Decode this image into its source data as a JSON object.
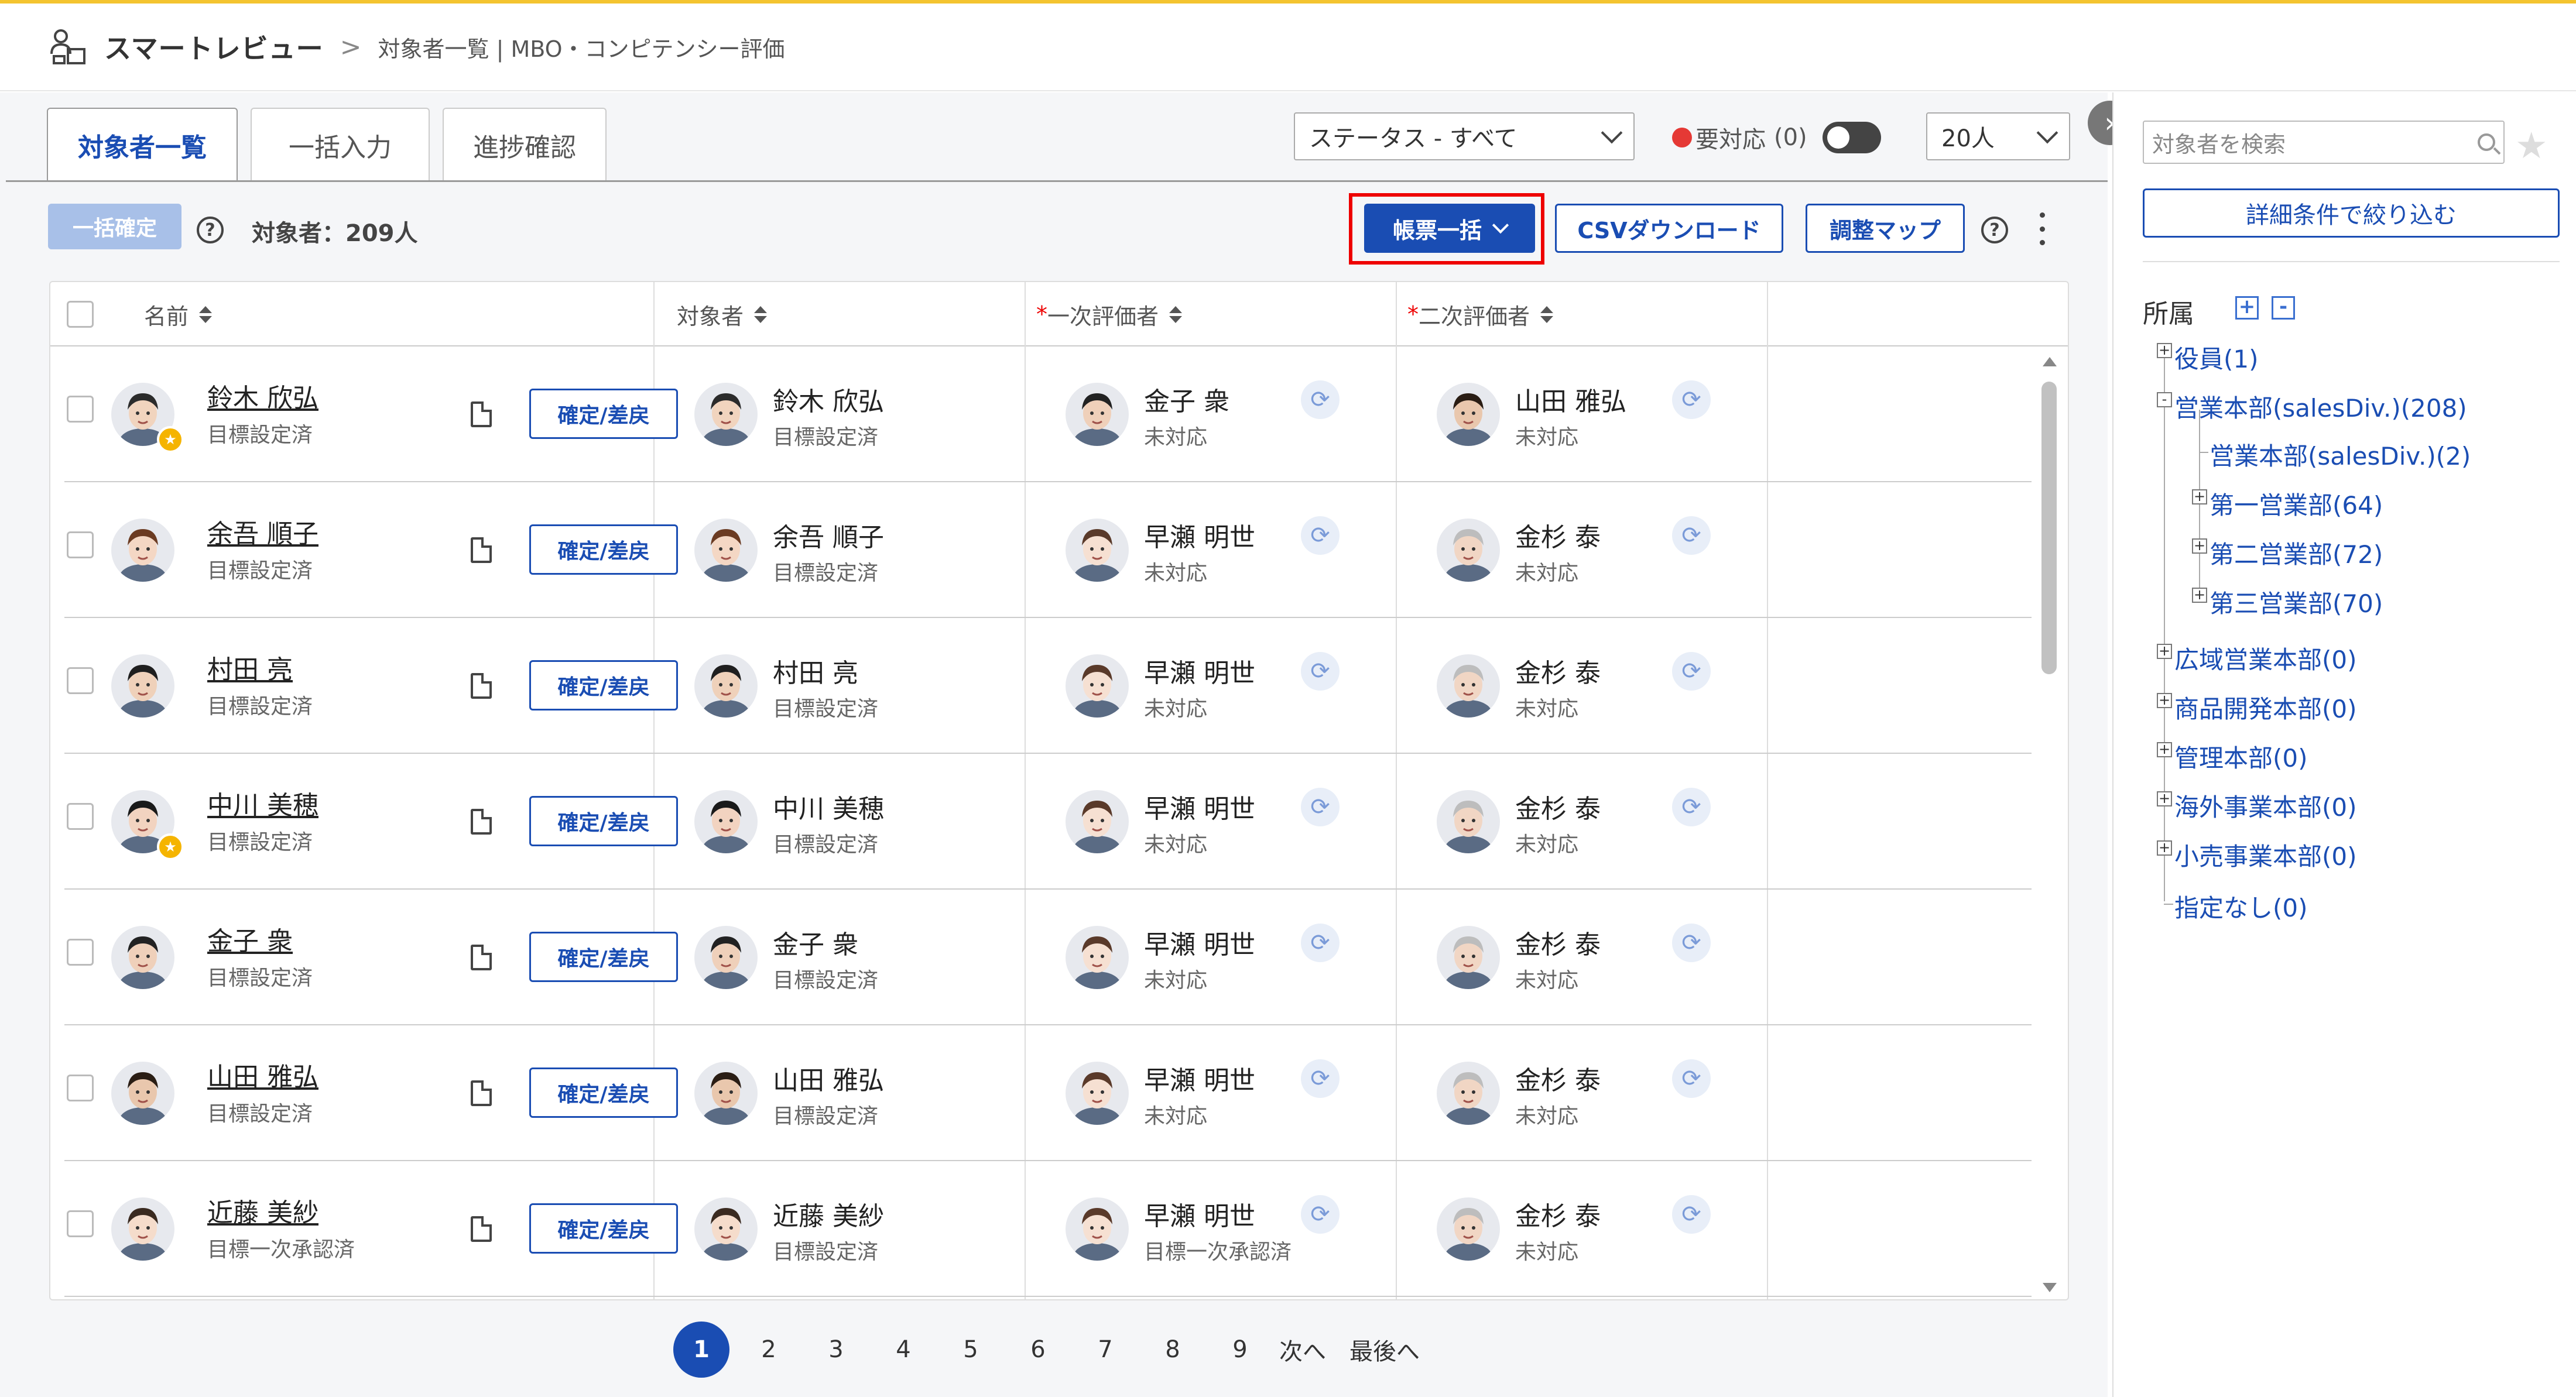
{
  "header": {
    "app_name": "スマートレビュー",
    "breadcrumb_sep": ">",
    "breadcrumb": "対象者一覧 | MBO・コンピテンシー評価"
  },
  "tabs": [
    {
      "label": "対象者一覧"
    },
    {
      "label": "一括入力"
    },
    {
      "label": "進捗確認"
    }
  ],
  "filters": {
    "status": "ステータス - すべて",
    "needs_action_label": "要対応",
    "needs_action_count": "(0)",
    "page_size": "20人"
  },
  "toolbar": {
    "bulk_confirm": "一括確定",
    "help": "?",
    "target_count": "対象者：209人",
    "forms_bulk": "帳票一括",
    "csv_download": "CSVダウンロード",
    "adjust_map": "調整マップ"
  },
  "table": {
    "headers": {
      "name": "名前",
      "target": "対象者",
      "first": "一次評価者",
      "second": "二次評価者",
      "required_mark": "*"
    },
    "action_label": "確定/差戻",
    "rows": [
      {
        "name": "鈴木 欣弘",
        "status": "目標設定済",
        "starred": true,
        "target": "鈴木 欣弘",
        "target_status": "目標設定済",
        "first": "金子 衆",
        "first_status": "未対応",
        "second": "山田 雅弘",
        "second_status": "未対応"
      },
      {
        "name": "余吾 順子",
        "status": "目標設定済",
        "starred": false,
        "target": "余吾 順子",
        "target_status": "目標設定済",
        "first": "早瀬 明世",
        "first_status": "未対応",
        "second": "金杉 泰",
        "second_status": "未対応"
      },
      {
        "name": "村田 亮",
        "status": "目標設定済",
        "starred": false,
        "target": "村田 亮",
        "target_status": "目標設定済",
        "first": "早瀬 明世",
        "first_status": "未対応",
        "second": "金杉 泰",
        "second_status": "未対応"
      },
      {
        "name": "中川 美穂",
        "status": "目標設定済",
        "starred": true,
        "target": "中川 美穂",
        "target_status": "目標設定済",
        "first": "早瀬 明世",
        "first_status": "未対応",
        "second": "金杉 泰",
        "second_status": "未対応"
      },
      {
        "name": "金子 衆",
        "status": "目標設定済",
        "starred": false,
        "target": "金子 衆",
        "target_status": "目標設定済",
        "first": "早瀬 明世",
        "first_status": "未対応",
        "second": "金杉 泰",
        "second_status": "未対応"
      },
      {
        "name": "山田 雅弘",
        "status": "目標設定済",
        "starred": false,
        "target": "山田 雅弘",
        "target_status": "目標設定済",
        "first": "早瀬 明世",
        "first_status": "未対応",
        "second": "金杉 泰",
        "second_status": "未対応"
      },
      {
        "name": "近藤 美紗",
        "status": "目標一次承認済",
        "starred": false,
        "target": "近藤 美紗",
        "target_status": "目標設定済",
        "first": "早瀬 明世",
        "first_status": "目標一次承認済",
        "second": "金杉 泰",
        "second_status": "未対応"
      }
    ]
  },
  "pagination": {
    "pages": [
      "1",
      "2",
      "3",
      "4",
      "5",
      "6",
      "7",
      "8",
      "9"
    ],
    "current": "1",
    "next": "次へ",
    "last": "最後へ"
  },
  "sidebar": {
    "search_placeholder": "対象者を検索",
    "filter_button": "詳細条件で絞り込む",
    "tree_title": "所属",
    "expand_all": "+",
    "collapse_all": "-",
    "nodes": [
      {
        "label": "役員(1)",
        "toggle": "+"
      },
      {
        "label": "営業本部(salesDiv.)(208)",
        "toggle": "-"
      },
      {
        "label": "営業本部(salesDiv.)(2)",
        "toggle": ""
      },
      {
        "label": "第一営業部(64)",
        "toggle": "+"
      },
      {
        "label": "第二営業部(72)",
        "toggle": "+"
      },
      {
        "label": "第三営業部(70)",
        "toggle": "+"
      },
      {
        "label": "広域営業本部(0)",
        "toggle": "+"
      },
      {
        "label": "商品開発本部(0)",
        "toggle": "+"
      },
      {
        "label": "管理本部(0)",
        "toggle": "+"
      },
      {
        "label": "海外事業本部(0)",
        "toggle": "+"
      },
      {
        "label": "小売事業本部(0)",
        "toggle": "+"
      },
      {
        "label": "指定なし(0)",
        "toggle": ""
      }
    ]
  },
  "colors": {
    "accent": "#1a4db3",
    "highlight_frame": "#e00000",
    "top_bar": "#f4c430",
    "status_dot": "#e53935",
    "star_badge": "#f5b400"
  }
}
